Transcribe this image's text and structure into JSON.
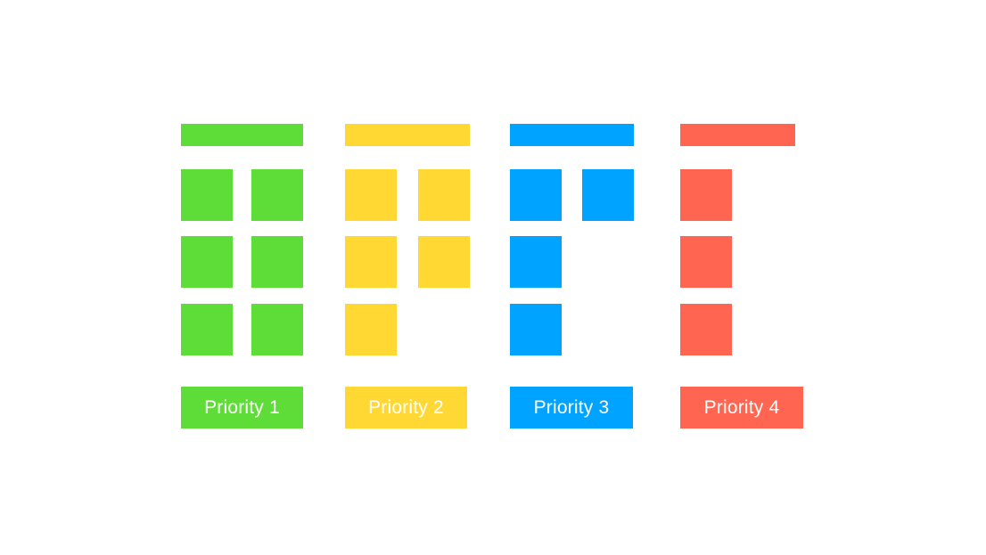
{
  "priorities": [
    {
      "label": "Priority 1",
      "color": "#5edc37",
      "tile_count": 6
    },
    {
      "label": "Priority 2",
      "color": "#ffd833",
      "tile_count": 5
    },
    {
      "label": "Priority 3",
      "color": "#00a3ff",
      "tile_count": 4
    },
    {
      "label": "Priority 4",
      "color": "#ff6550",
      "tile_count": 3
    }
  ]
}
